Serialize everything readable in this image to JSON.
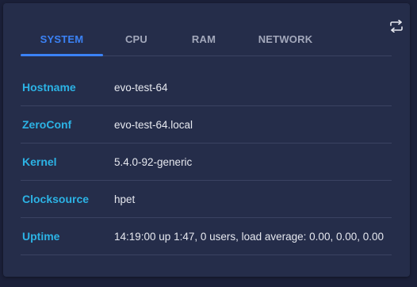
{
  "tabs": [
    {
      "label": "SYSTEM",
      "active": true
    },
    {
      "label": "CPU",
      "active": false
    },
    {
      "label": "RAM",
      "active": false
    },
    {
      "label": "NETWORK",
      "active": false
    }
  ],
  "toolbar": {
    "swap_icon": "swap-arrows-icon"
  },
  "system": {
    "rows": [
      {
        "label": "Hostname",
        "value": "evo-test-64"
      },
      {
        "label": "ZeroConf",
        "value": "evo-test-64.local"
      },
      {
        "label": "Kernel",
        "value": "5.4.0-92-generic"
      },
      {
        "label": "Clocksource",
        "value": "hpet"
      },
      {
        "label": "Uptime",
        "value": "14:19:00 up 1:47, 0 users, load average: 0.00, 0.00, 0.00"
      }
    ]
  },
  "colors": {
    "accent": "#3b82f6",
    "label": "#2cb3e5",
    "background": "#1b2039",
    "card": "#252d4a"
  }
}
